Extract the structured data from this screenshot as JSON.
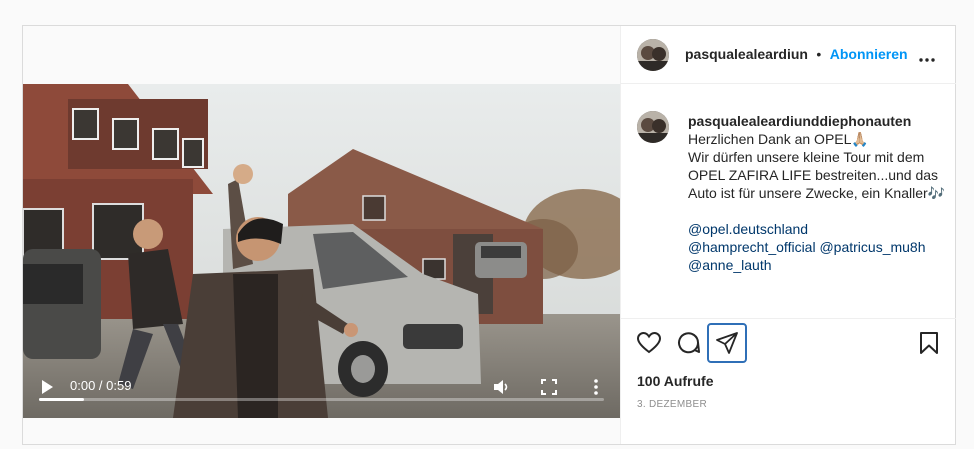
{
  "post": {
    "author": "pasqualealeardiun",
    "follow_label": "Abonnieren",
    "separator": "•",
    "caption_author": "pasqualealeardiunddiephonauten",
    "caption_lines": [
      "Herzlichen Dank an OPEL🙏🏼",
      "Wir dürfen unsere kleine Tour mit dem OPEL ZAFIRA LIFE bestreiten...und das Auto ist für unsere Zwecke, ein Knaller🎶"
    ],
    "mentions": [
      "@opel.deutschland",
      "@hamprecht_official",
      "@patricus_mu8h",
      "@anne_lauth"
    ],
    "views": "100 Aufrufe",
    "date": "3. DEZEMBER"
  },
  "video": {
    "time": "0:00 / 0:59",
    "progress": 0.08
  },
  "icons": {
    "play": "play-icon",
    "volume": "volume-icon",
    "fullscreen": "fullscreen-icon",
    "more_video": "more-vertical-icon",
    "like": "heart-icon",
    "comment": "comment-icon",
    "share": "send-icon",
    "save": "bookmark-icon",
    "more": "more-horizontal-icon"
  },
  "colors": {
    "accent": "#0095f6",
    "mention": "#00376b",
    "share_highlight": "#2f6fb7"
  }
}
